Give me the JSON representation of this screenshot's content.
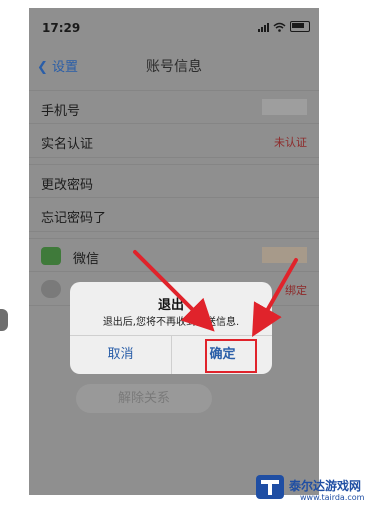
{
  "status_bar": {
    "time": "17:29"
  },
  "nav": {
    "back_label": "设置",
    "title": "账号信息"
  },
  "rows": [
    {
      "label": "手机号"
    },
    {
      "label": "实名认证",
      "value": "未认证"
    },
    {
      "label": "更改密码"
    },
    {
      "label": "忘记密码了"
    },
    {
      "label": "微信"
    },
    {
      "value": "绑定"
    }
  ],
  "dialog": {
    "title": "退出",
    "message": "退出后,您将不再收到推送信息.",
    "cancel_label": "取消",
    "confirm_label": "确定"
  },
  "unbind_label": "解除关系",
  "watermark": {
    "text": "泰尔达游戏网",
    "url": "www.tairda.com"
  },
  "colors": {
    "annotation": "#e0232b",
    "link": "#2a5ea8"
  }
}
